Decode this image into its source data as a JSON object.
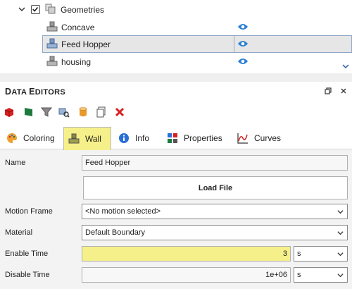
{
  "tree": {
    "root_label": "Geometries",
    "items": [
      {
        "label": "Concave"
      },
      {
        "label": "Feed Hopper"
      },
      {
        "label": "housing"
      }
    ]
  },
  "data_editors": {
    "title_first": "D",
    "title_rest": "ATA ",
    "title_second": "E",
    "title_rest2": "DITORS"
  },
  "tabs": [
    {
      "label": "Coloring"
    },
    {
      "label": "Wall"
    },
    {
      "label": "Info"
    },
    {
      "label": "Properties"
    },
    {
      "label": "Curves"
    }
  ],
  "form": {
    "name_label": "Name",
    "name_value": "Feed Hopper",
    "load_file_label": "Load File",
    "motion_frame_label": "Motion Frame",
    "motion_frame_value": "<No motion selected>",
    "material_label": "Material",
    "material_value": "Default Boundary",
    "enable_time_label": "Enable Time",
    "enable_time_value": "3",
    "enable_time_unit": "s",
    "disable_time_label": "Disable Time",
    "disable_time_value": "1e+06",
    "disable_time_unit": "s"
  },
  "colors": {
    "accent_yellow": "#f6f08a",
    "selection_border": "#8fa8c8",
    "eye_blue": "#2a7fd4"
  }
}
